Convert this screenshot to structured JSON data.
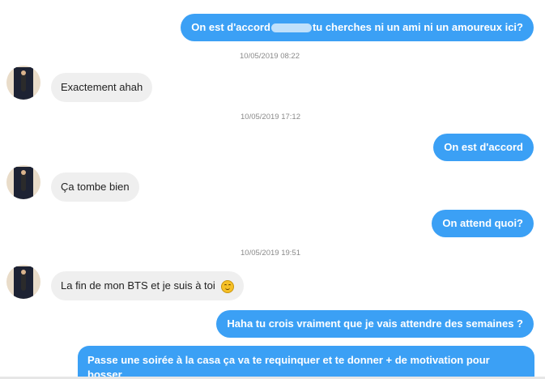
{
  "messages": [
    {
      "type": "out",
      "text_before": "On est d'accord",
      "text_after": "tu cherches ni un ami ni un amoureux ici?"
    },
    {
      "type": "stamp",
      "text": "10/05/2019 08:22"
    },
    {
      "type": "in",
      "text": "Exactement ahah"
    },
    {
      "type": "stamp",
      "text": "10/05/2019 17:12"
    },
    {
      "type": "out",
      "text": "On est d'accord"
    },
    {
      "type": "in",
      "text": "Ça tombe bien"
    },
    {
      "type": "out",
      "text": "On attend quoi?"
    },
    {
      "type": "stamp",
      "text": "10/05/2019 19:51"
    },
    {
      "type": "in",
      "text": "La fin de mon BTS et je suis à toi",
      "emoji": "smiling-face-emoji"
    },
    {
      "type": "out",
      "text": "Haha tu crois vraiment que je vais attendre des semaines ?"
    },
    {
      "type": "out",
      "text": "Passe une soirée à la casa ça va te requinquer et te donner + de motivation pour bosser"
    }
  ],
  "colors": {
    "outgoing_bubble": "#3ba0f5",
    "incoming_bubble": "#efefef",
    "timestamp": "#8a8a8a"
  }
}
